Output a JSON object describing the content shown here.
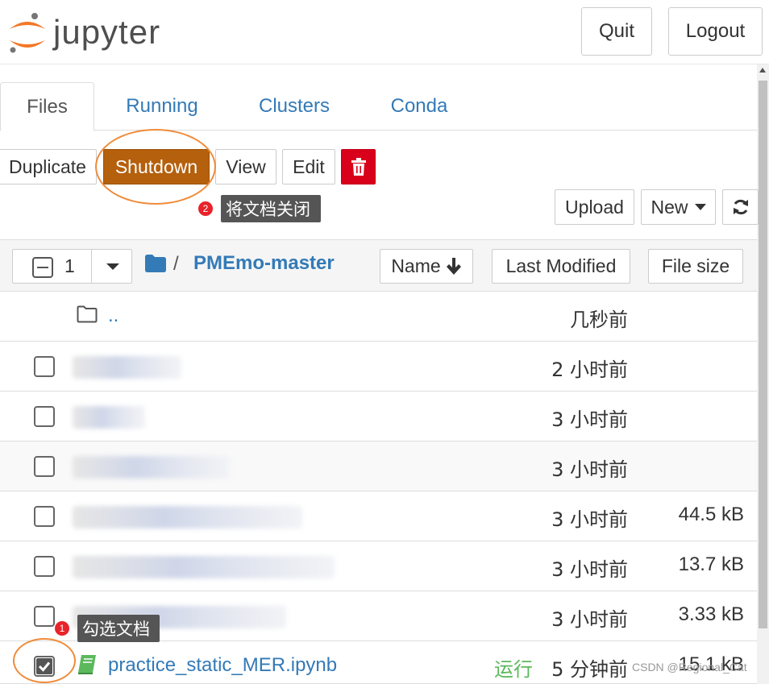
{
  "app": {
    "logo_text": "jupyter",
    "quit_label": "Quit",
    "logout_label": "Logout"
  },
  "tabs": [
    {
      "label": "Files",
      "active": true
    },
    {
      "label": "Running",
      "active": false
    },
    {
      "label": "Clusters",
      "active": false
    },
    {
      "label": "Conda",
      "active": false
    }
  ],
  "toolbar": {
    "duplicate_label": "Duplicate",
    "shutdown_label": "Shutdown",
    "view_label": "View",
    "edit_label": "Edit",
    "delete_icon": "trash-icon",
    "upload_label": "Upload",
    "new_label": "New",
    "refresh_icon": "refresh-icon"
  },
  "annotations": {
    "tip_close": "将文档关闭",
    "tip_select": "勾选文档",
    "badge_1": "1",
    "badge_2": "2",
    "oval_color": "#ef8b3a"
  },
  "list_header": {
    "selected_count": "1",
    "path_slash": "/",
    "path_folder": "PMEmo-master",
    "sort_name": "Name",
    "sort_modified": "Last Modified",
    "sort_size": "File size"
  },
  "rows": [
    {
      "name": "..",
      "time": "几秒前",
      "size": "",
      "type": "parent"
    },
    {
      "name": "",
      "time": "2 小时前",
      "size": "",
      "type": "folder"
    },
    {
      "name": "",
      "time": "3 小时前",
      "size": "",
      "type": "folder"
    },
    {
      "name": "",
      "time": "3 小时前",
      "size": "",
      "type": "folder"
    },
    {
      "name": "",
      "time": "3 小时前",
      "size": "44.5 kB",
      "type": "file"
    },
    {
      "name": "",
      "time": "3 小时前",
      "size": "13.7 kB",
      "type": "file"
    },
    {
      "name": "",
      "time": "3 小时前",
      "size": "3.33 kB",
      "type": "file"
    },
    {
      "name": "practice_static_MER.ipynb",
      "time": "5 分钟前",
      "size": "15.1 kB",
      "type": "notebook",
      "status": "运行",
      "checked": true
    }
  ],
  "watermark": "CSDN @Regional_Cat",
  "colors": {
    "shutdown": "#b5600d",
    "delete": "#d9001b",
    "link": "#337ab7",
    "running": "#5cb85c"
  }
}
